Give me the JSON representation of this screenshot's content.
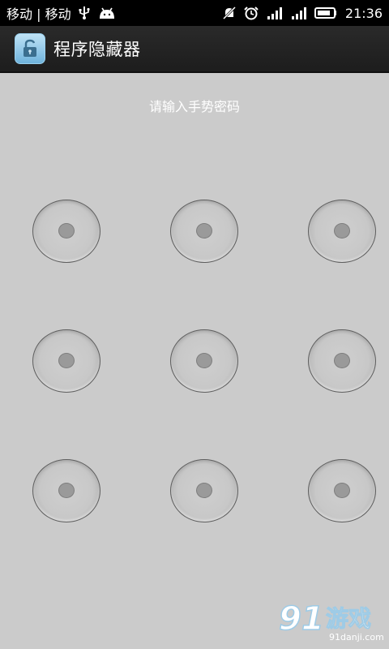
{
  "status_bar": {
    "carrier": "移动 | 移动",
    "icons_left": [
      "usb-icon",
      "android-debug-icon"
    ],
    "icons_right": [
      "mute-icon",
      "alarm-icon",
      "signal-icon",
      "signal-icon",
      "battery-icon"
    ],
    "time": "21:36"
  },
  "app_bar": {
    "title": "程序隐藏器",
    "icon": "lock-icon",
    "accent": "#6fb3dc"
  },
  "prompt": "请输入手势密码",
  "pattern": {
    "rows": 3,
    "cols": 3,
    "nodes": [
      1,
      2,
      3,
      4,
      5,
      6,
      7,
      8,
      9
    ]
  },
  "watermark": {
    "logo_text": "91游戏",
    "site": "91danji.com"
  },
  "colors": {
    "background": "#cbcbcb",
    "app_bar": "#1f1f1f",
    "status_bar": "#000000"
  }
}
